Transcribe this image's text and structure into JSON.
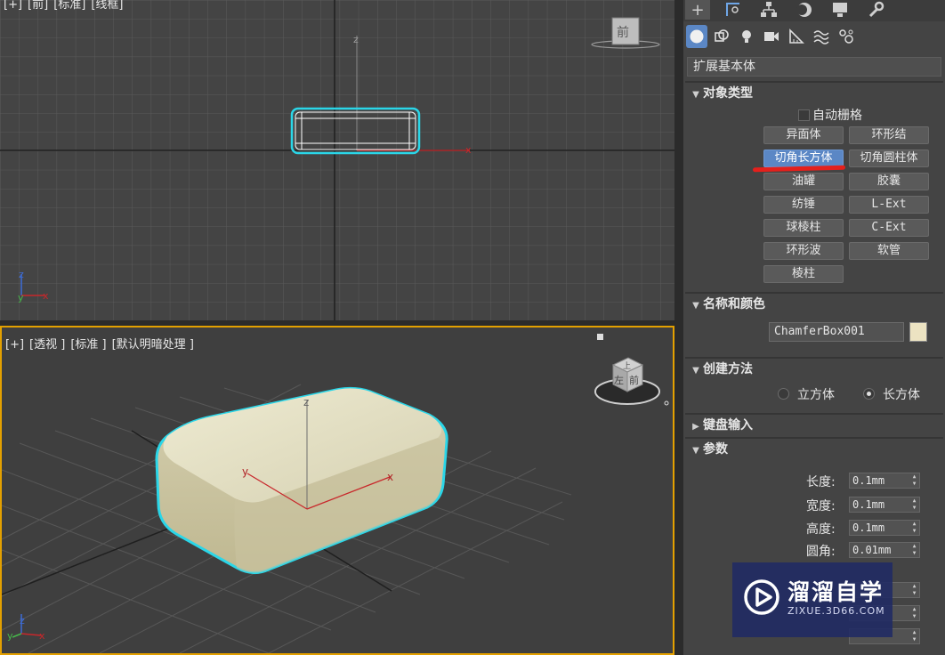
{
  "front_viewport": {
    "label_parts": [
      "[+]",
      "[前]",
      "[标准]",
      "[线框]"
    ],
    "viewcube_face": "前",
    "axis_z": "z",
    "axis_x": "x",
    "triad": {
      "z": "z",
      "y": "y",
      "x": "x"
    }
  },
  "persp_viewport": {
    "label_parts": [
      "[+]",
      "[透视 ]",
      "[标准 ]",
      "[默认明暗处理 ]"
    ],
    "viewcube_faces": {
      "top": "上",
      "left": "左",
      "front": "前"
    },
    "axis_labels": {
      "z": "z",
      "y": "y",
      "x": "x"
    },
    "triad": {
      "z": "z",
      "y": "y",
      "x": "x"
    },
    "object_color": "#e6e2c6",
    "selection_color": "#2ad6e8"
  },
  "command_panel": {
    "main_tabs": [
      "create-icon",
      "modify-icon",
      "hierarchy-icon",
      "motion-icon",
      "display-icon",
      "utilities-icon"
    ],
    "sub_tabs": [
      "geometry-icon",
      "shapes-icon",
      "lights-icon",
      "cameras-icon",
      "helpers-icon",
      "spacewarps-icon",
      "systems-icon"
    ],
    "category": "扩展基本体",
    "object_type": {
      "title": "对象类型",
      "autogrid_label": "自动栅格",
      "buttons": [
        [
          "异面体",
          "环形结"
        ],
        [
          "切角长方体",
          "切角圆柱体"
        ],
        [
          "油罐",
          "胶囊"
        ],
        [
          "纺锤",
          "L-Ext"
        ],
        [
          "球棱柱",
          "C-Ext"
        ],
        [
          "环形波",
          "软管"
        ],
        [
          "棱柱"
        ]
      ],
      "active": "切角长方体"
    },
    "name_color": {
      "title": "名称和颜色",
      "name_value": "ChamferBox001",
      "swatch_color": "#ece3c2"
    },
    "creation_method": {
      "title": "创建方法",
      "options": [
        "立方体",
        "长方体"
      ],
      "selected": "长方体"
    },
    "keyboard_entry": {
      "title": "键盘输入"
    },
    "parameters": {
      "title": "参数",
      "fields": [
        {
          "label": "长度:",
          "value": "0.1mm"
        },
        {
          "label": "宽度:",
          "value": "0.1mm"
        },
        {
          "label": "高度:",
          "value": "0.1mm"
        },
        {
          "label": "圆角:",
          "value": "0.01mm"
        }
      ]
    }
  },
  "watermark": {
    "title": "溜溜自学",
    "url": "ZIXUE.3D66.COM"
  }
}
